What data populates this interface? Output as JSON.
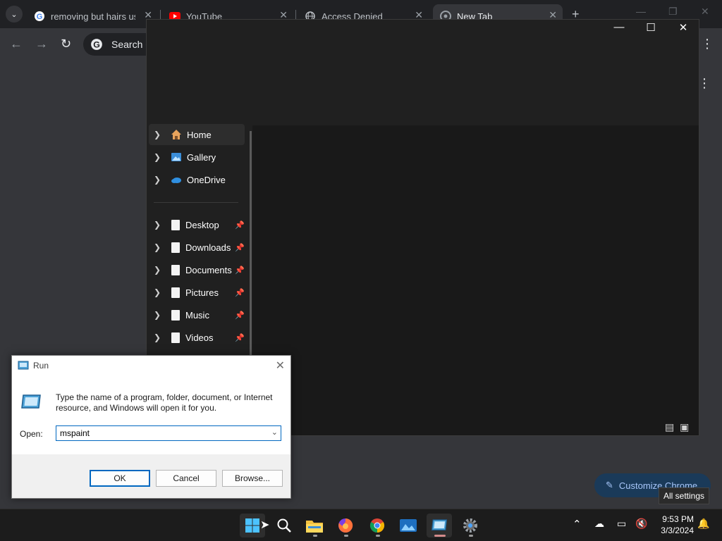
{
  "browser": {
    "tabs": [
      {
        "title": "removing but hairs usi",
        "favicon": "google-icon"
      },
      {
        "title": "YouTube",
        "favicon": "youtube-icon"
      },
      {
        "title": "Access Denied",
        "favicon": "globe-icon"
      },
      {
        "title": "New Tab",
        "favicon": "chrome-icon"
      }
    ],
    "omnibox_placeholder": "Search G",
    "customize_label": "Customize Chrome",
    "tooltip": "All settings"
  },
  "explorer": {
    "nav_primary": [
      {
        "label": "Home"
      },
      {
        "label": "Gallery"
      },
      {
        "label": "OneDrive"
      }
    ],
    "nav_quick": [
      {
        "label": "Desktop"
      },
      {
        "label": "Downloads"
      },
      {
        "label": "Documents"
      },
      {
        "label": "Pictures"
      },
      {
        "label": "Music"
      },
      {
        "label": "Videos"
      }
    ]
  },
  "run_dialog": {
    "title": "Run",
    "description": "Type the name of a program, folder, document, or Internet resource, and Windows will open it for you.",
    "open_label": "Open:",
    "input_value": "mspaint",
    "ok_label": "OK",
    "cancel_label": "Cancel",
    "browse_label": "Browse..."
  },
  "taskbar": {
    "time": "9:53 PM",
    "date": "3/3/2024"
  },
  "colors": {
    "chrome_bg": "#35363a",
    "explorer_bg": "#191919",
    "accent": "#0067c0",
    "customize_bg": "#1a3a59"
  }
}
